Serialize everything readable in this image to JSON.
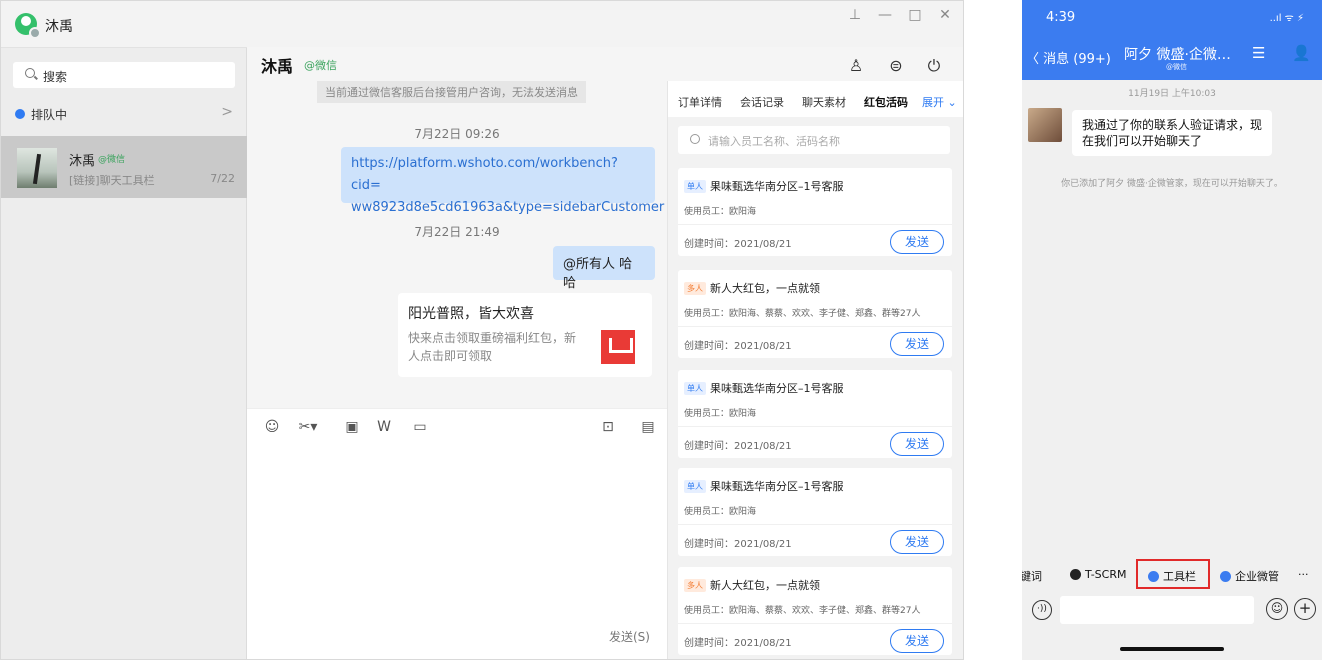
{
  "desktop": {
    "title": "沐禹",
    "window_controls": {
      "pin": "⊥",
      "minimize": "—",
      "maximize": "□",
      "close": "✕"
    },
    "sidebar": {
      "search_placeholder": "搜索",
      "queue_label": "排队中",
      "queue_chevron": ">",
      "conversation": {
        "name": "沐禹",
        "tag": "@微信",
        "preview": "[链接]聊天工具栏",
        "date": "7/22"
      }
    },
    "chat": {
      "title": "沐禹",
      "title_tag": "@微信",
      "notice": "当前通过微信客服后台接管用户咨询，无法发送消息",
      "time1": "7月22日 09:26",
      "link_line1": "https://platform.wshoto.com/workbench?cid=",
      "link_line2": "ww8923d8e5cd61963a&type=sidebarCustomer",
      "time2": "7月22日 21:49",
      "at_message": "@所有人 哈哈",
      "card_title": "阳光普照，皆大欢喜",
      "card_desc": "快来点击领取重磅福利红包，新人点击即可领取",
      "send_label": "发送(S)"
    },
    "panel": {
      "tabs": [
        "订单详情",
        "会话记录",
        "聊天素材",
        "红包活码",
        "展开 ⌄"
      ],
      "search_placeholder": "请输入员工名称、活码名称",
      "items": [
        {
          "tag": "单人",
          "tag_color": "blue",
          "title": "果味甄选华南分区–1号客服",
          "employees": "使用员工：欧阳海",
          "created": "创建时间：2021/08/21",
          "button": "发送"
        },
        {
          "tag": "多人",
          "tag_color": "orange",
          "title": "新人大红包，一点就领",
          "employees": "使用员工：欧阳海、蔡蔡、欢欢、李子健、郑鑫、群等27人",
          "created": "创建时间：2021/08/21",
          "button": "发送"
        },
        {
          "tag": "单人",
          "tag_color": "blue",
          "title": "果味甄选华南分区–1号客服",
          "employees": "使用员工：欧阳海",
          "created": "创建时间：2021/08/21",
          "button": "发送"
        },
        {
          "tag": "单人",
          "tag_color": "blue",
          "title": "果味甄选华南分区–1号客服",
          "employees": "使用员工：欧阳海",
          "created": "创建时间：2021/08/21",
          "button": "发送"
        },
        {
          "tag": "多人",
          "tag_color": "orange",
          "title": "新人大红包，一点就领",
          "employees": "使用员工：欧阳海、蔡蔡、欢欢、李子健、郑鑫、群等27人",
          "created": "创建时间：2021/08/21",
          "button": "发送"
        }
      ]
    }
  },
  "phone": {
    "time": "4:39",
    "signal": "..ıl ᯤ ⚡",
    "back": "〈 消息 (99+)",
    "title": "阿夕 微盛·企微…",
    "subtitle": "@微信",
    "timestamp": "11月19日 上午10:03",
    "message": "我通过了你的联系人验证请求，现在我们可以开始聊天了",
    "tip": "你已添加了阿夕 微盛·企微管家，现在可以开始聊天了。",
    "chips": [
      "键词",
      "T-SCRM",
      "工具栏",
      "企业微管",
      "···"
    ]
  },
  "colors": {
    "accent": "#2f7bf2",
    "phone_bar": "#3b7cf0",
    "highlight": "#e12a2a",
    "wechat_green": "#3aa35d"
  }
}
